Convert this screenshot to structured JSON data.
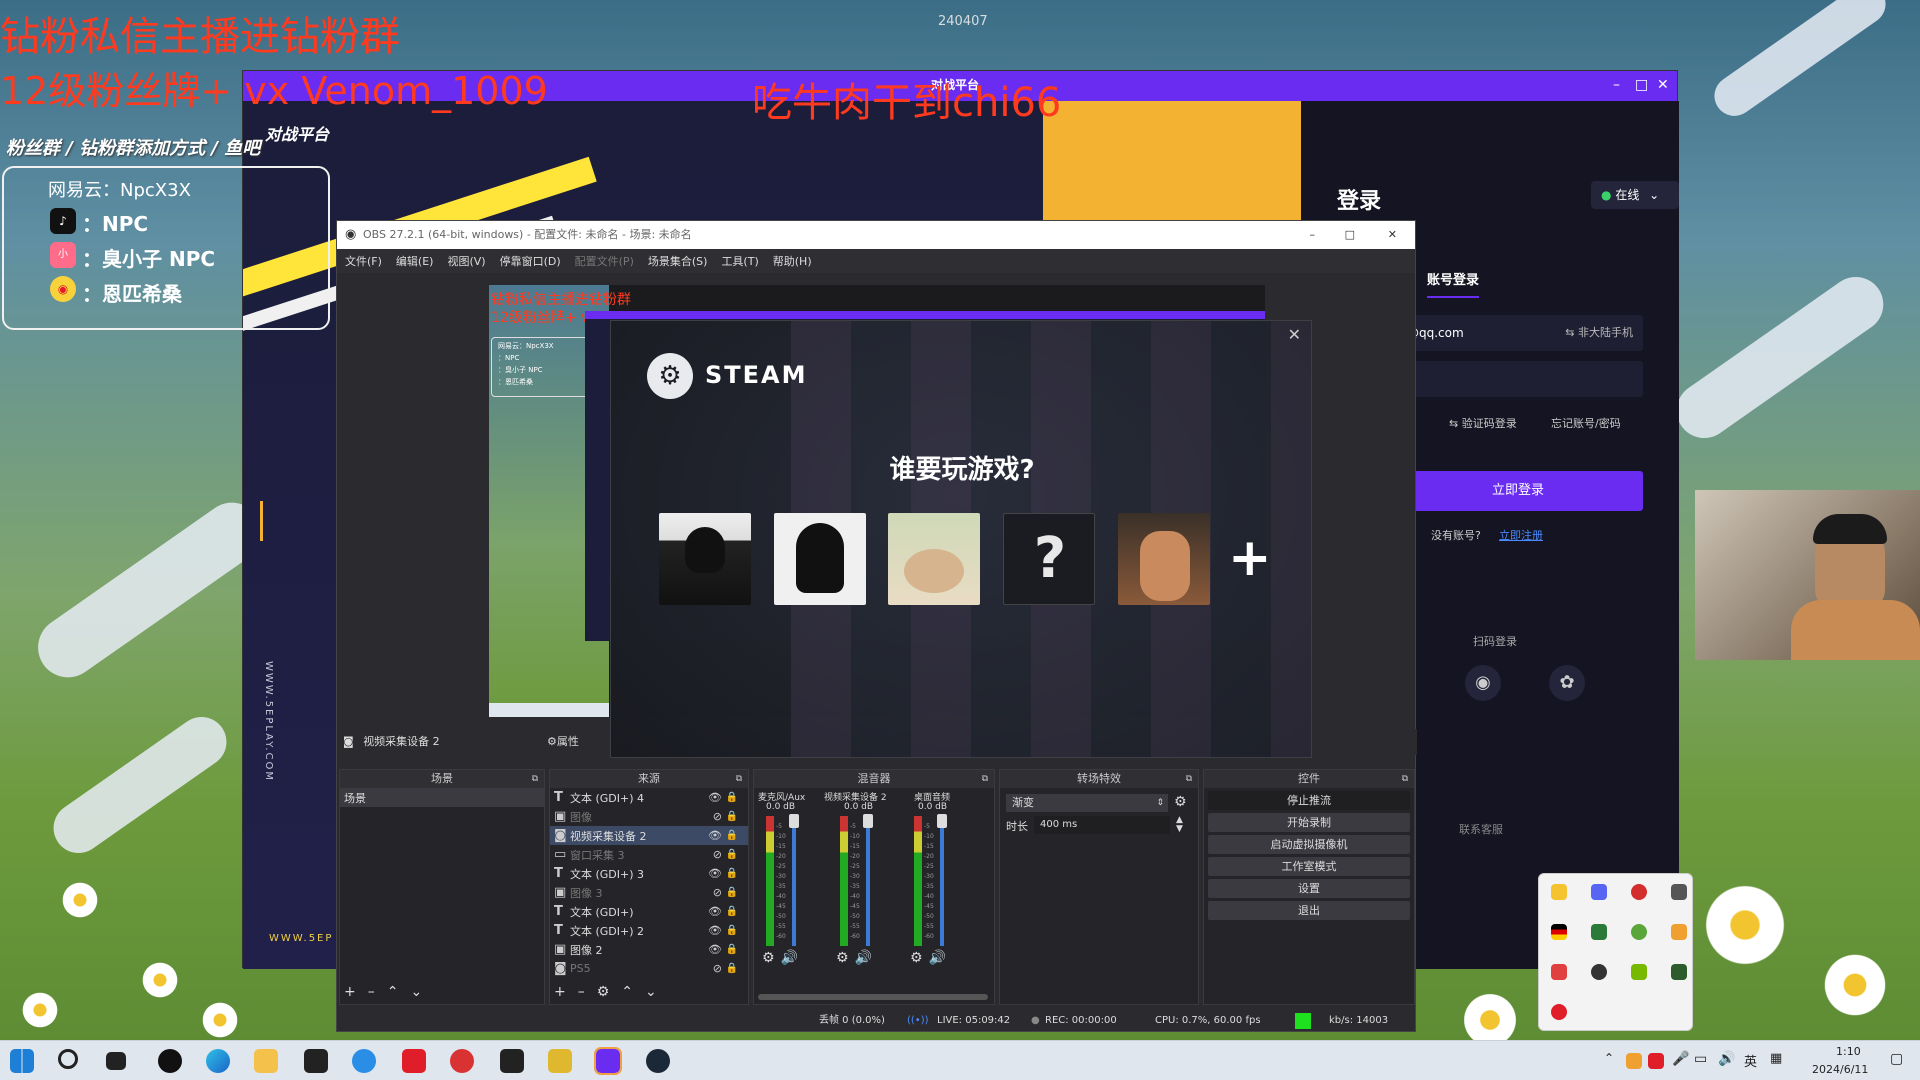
{
  "overlay": {
    "top_line1": "钻粉私信主播进钻粉群",
    "top_line2": "12级粉丝牌+ vx Venom_1009",
    "center_red": "吃牛肉干到chi66",
    "stream_id": "240407",
    "fan_group_text": "粉丝群 / 钻粉群添加方式 / 鱼吧",
    "info_box": {
      "netease": "网易云：NpcX3X",
      "douyin": "：NPC",
      "xhs": "：臭小子 NPC",
      "weibo": "：恩匹希桑"
    }
  },
  "zhanping": {
    "logo": "对战平台",
    "site_vertical": "WWW.5EPLAY.COM",
    "site_bottom": "WWW.5EP",
    "login_title": "登录",
    "status": "在线",
    "tab_account": "账号登录",
    "account_value": "@qq.com",
    "non_mainland": "⇆ 非大陆手机",
    "sms_login": "⇆ 验证码登录",
    "forgot": "忘记账号/密码",
    "login_button": "立即登录",
    "no_account": "没有账号?",
    "register": "立即注册",
    "qr_login": "扫码登录",
    "contact": "联系客服"
  },
  "obs": {
    "title": "OBS 27.2.1 (64-bit, windows) - 配置文件: 未命名 - 场景: 未命名",
    "menu": [
      "文件(F)",
      "编辑(E)",
      "视图(V)",
      "停靠窗口(D)",
      "配置文件(P)",
      "场景集合(S)",
      "工具(T)",
      "帮助(H)"
    ],
    "source_bar_label": "视频采集设备 2",
    "properties": "属性",
    "docks": {
      "scenes": "场景",
      "sources": "来源",
      "mixer": "混音器",
      "transitions": "转场特效",
      "controls": "控件"
    },
    "scene_item": "场景",
    "sources": [
      {
        "icon": "T",
        "label": "文本 (GDI+) 4"
      },
      {
        "icon": "▣",
        "label": "图像"
      },
      {
        "icon": "◙",
        "label": "视频采集设备 2"
      },
      {
        "icon": "▭",
        "label": "窗口采集 3"
      },
      {
        "icon": "T",
        "label": "文本 (GDI+) 3"
      },
      {
        "icon": "▣",
        "label": "图像 3"
      },
      {
        "icon": "T",
        "label": "文本 (GDI+)"
      },
      {
        "icon": "T",
        "label": "文本 (GDI+) 2"
      },
      {
        "icon": "▣",
        "label": "图像 2"
      },
      {
        "icon": "◙",
        "label": "PS5"
      }
    ],
    "mixer": [
      {
        "name": "麦克风/Aux",
        "db": "0.0 dB"
      },
      {
        "name": "视频采集设备 2",
        "db": "0.0 dB"
      },
      {
        "name": "桌面音频",
        "db": "0.0 dB"
      }
    ],
    "meter_ticks": [
      "-5",
      "-10",
      "-15",
      "-20",
      "-25",
      "-30",
      "-35",
      "-40",
      "-45",
      "-50",
      "-55",
      "-60"
    ],
    "transition": {
      "value": "渐变",
      "duration_label": "时长",
      "duration_value": "400 ms"
    },
    "controls": [
      "停止推流",
      "开始录制",
      "启动虚拟摄像机",
      "工作室模式",
      "设置",
      "退出"
    ],
    "status": {
      "dropped": "丢帧 0 (0.0%)",
      "live": "LIVE: 05:09:42",
      "rec": "REC: 00:00:00",
      "cpu": "CPU: 0.7%, 60.00 fps",
      "kbs": "kb/s: 14003"
    }
  },
  "steam": {
    "brand": "STEAM",
    "prompt": "谁要玩游戏?",
    "unknown_avatar": "?",
    "add": "+"
  },
  "taskbar": {
    "ime": "英",
    "time": "1:10",
    "date": "2024/6/11"
  },
  "colors": {
    "accent": "#6a2cf0",
    "overlay_red": "#ff3a1e",
    "steam_bg": "#1b1d24",
    "obs_bg": "#2b2b2f"
  }
}
